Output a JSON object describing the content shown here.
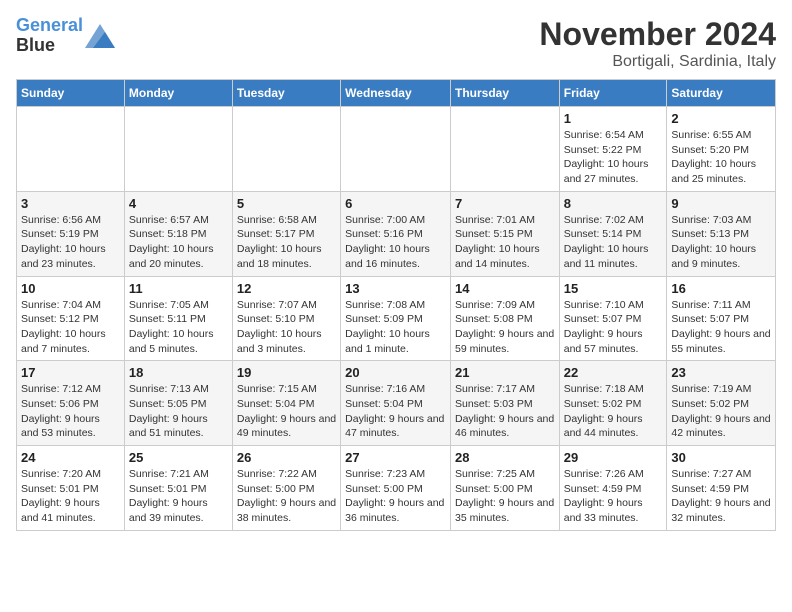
{
  "logo": {
    "line1": "General",
    "line2": "Blue"
  },
  "title": "November 2024",
  "location": "Bortigali, Sardinia, Italy",
  "weekdays": [
    "Sunday",
    "Monday",
    "Tuesday",
    "Wednesday",
    "Thursday",
    "Friday",
    "Saturday"
  ],
  "weeks": [
    [
      {
        "day": "",
        "info": ""
      },
      {
        "day": "",
        "info": ""
      },
      {
        "day": "",
        "info": ""
      },
      {
        "day": "",
        "info": ""
      },
      {
        "day": "",
        "info": ""
      },
      {
        "day": "1",
        "info": "Sunrise: 6:54 AM\nSunset: 5:22 PM\nDaylight: 10 hours and 27 minutes."
      },
      {
        "day": "2",
        "info": "Sunrise: 6:55 AM\nSunset: 5:20 PM\nDaylight: 10 hours and 25 minutes."
      }
    ],
    [
      {
        "day": "3",
        "info": "Sunrise: 6:56 AM\nSunset: 5:19 PM\nDaylight: 10 hours and 23 minutes."
      },
      {
        "day": "4",
        "info": "Sunrise: 6:57 AM\nSunset: 5:18 PM\nDaylight: 10 hours and 20 minutes."
      },
      {
        "day": "5",
        "info": "Sunrise: 6:58 AM\nSunset: 5:17 PM\nDaylight: 10 hours and 18 minutes."
      },
      {
        "day": "6",
        "info": "Sunrise: 7:00 AM\nSunset: 5:16 PM\nDaylight: 10 hours and 16 minutes."
      },
      {
        "day": "7",
        "info": "Sunrise: 7:01 AM\nSunset: 5:15 PM\nDaylight: 10 hours and 14 minutes."
      },
      {
        "day": "8",
        "info": "Sunrise: 7:02 AM\nSunset: 5:14 PM\nDaylight: 10 hours and 11 minutes."
      },
      {
        "day": "9",
        "info": "Sunrise: 7:03 AM\nSunset: 5:13 PM\nDaylight: 10 hours and 9 minutes."
      }
    ],
    [
      {
        "day": "10",
        "info": "Sunrise: 7:04 AM\nSunset: 5:12 PM\nDaylight: 10 hours and 7 minutes."
      },
      {
        "day": "11",
        "info": "Sunrise: 7:05 AM\nSunset: 5:11 PM\nDaylight: 10 hours and 5 minutes."
      },
      {
        "day": "12",
        "info": "Sunrise: 7:07 AM\nSunset: 5:10 PM\nDaylight: 10 hours and 3 minutes."
      },
      {
        "day": "13",
        "info": "Sunrise: 7:08 AM\nSunset: 5:09 PM\nDaylight: 10 hours and 1 minute."
      },
      {
        "day": "14",
        "info": "Sunrise: 7:09 AM\nSunset: 5:08 PM\nDaylight: 9 hours and 59 minutes."
      },
      {
        "day": "15",
        "info": "Sunrise: 7:10 AM\nSunset: 5:07 PM\nDaylight: 9 hours and 57 minutes."
      },
      {
        "day": "16",
        "info": "Sunrise: 7:11 AM\nSunset: 5:07 PM\nDaylight: 9 hours and 55 minutes."
      }
    ],
    [
      {
        "day": "17",
        "info": "Sunrise: 7:12 AM\nSunset: 5:06 PM\nDaylight: 9 hours and 53 minutes."
      },
      {
        "day": "18",
        "info": "Sunrise: 7:13 AM\nSunset: 5:05 PM\nDaylight: 9 hours and 51 minutes."
      },
      {
        "day": "19",
        "info": "Sunrise: 7:15 AM\nSunset: 5:04 PM\nDaylight: 9 hours and 49 minutes."
      },
      {
        "day": "20",
        "info": "Sunrise: 7:16 AM\nSunset: 5:04 PM\nDaylight: 9 hours and 47 minutes."
      },
      {
        "day": "21",
        "info": "Sunrise: 7:17 AM\nSunset: 5:03 PM\nDaylight: 9 hours and 46 minutes."
      },
      {
        "day": "22",
        "info": "Sunrise: 7:18 AM\nSunset: 5:02 PM\nDaylight: 9 hours and 44 minutes."
      },
      {
        "day": "23",
        "info": "Sunrise: 7:19 AM\nSunset: 5:02 PM\nDaylight: 9 hours and 42 minutes."
      }
    ],
    [
      {
        "day": "24",
        "info": "Sunrise: 7:20 AM\nSunset: 5:01 PM\nDaylight: 9 hours and 41 minutes."
      },
      {
        "day": "25",
        "info": "Sunrise: 7:21 AM\nSunset: 5:01 PM\nDaylight: 9 hours and 39 minutes."
      },
      {
        "day": "26",
        "info": "Sunrise: 7:22 AM\nSunset: 5:00 PM\nDaylight: 9 hours and 38 minutes."
      },
      {
        "day": "27",
        "info": "Sunrise: 7:23 AM\nSunset: 5:00 PM\nDaylight: 9 hours and 36 minutes."
      },
      {
        "day": "28",
        "info": "Sunrise: 7:25 AM\nSunset: 5:00 PM\nDaylight: 9 hours and 35 minutes."
      },
      {
        "day": "29",
        "info": "Sunrise: 7:26 AM\nSunset: 4:59 PM\nDaylight: 9 hours and 33 minutes."
      },
      {
        "day": "30",
        "info": "Sunrise: 7:27 AM\nSunset: 4:59 PM\nDaylight: 9 hours and 32 minutes."
      }
    ]
  ]
}
